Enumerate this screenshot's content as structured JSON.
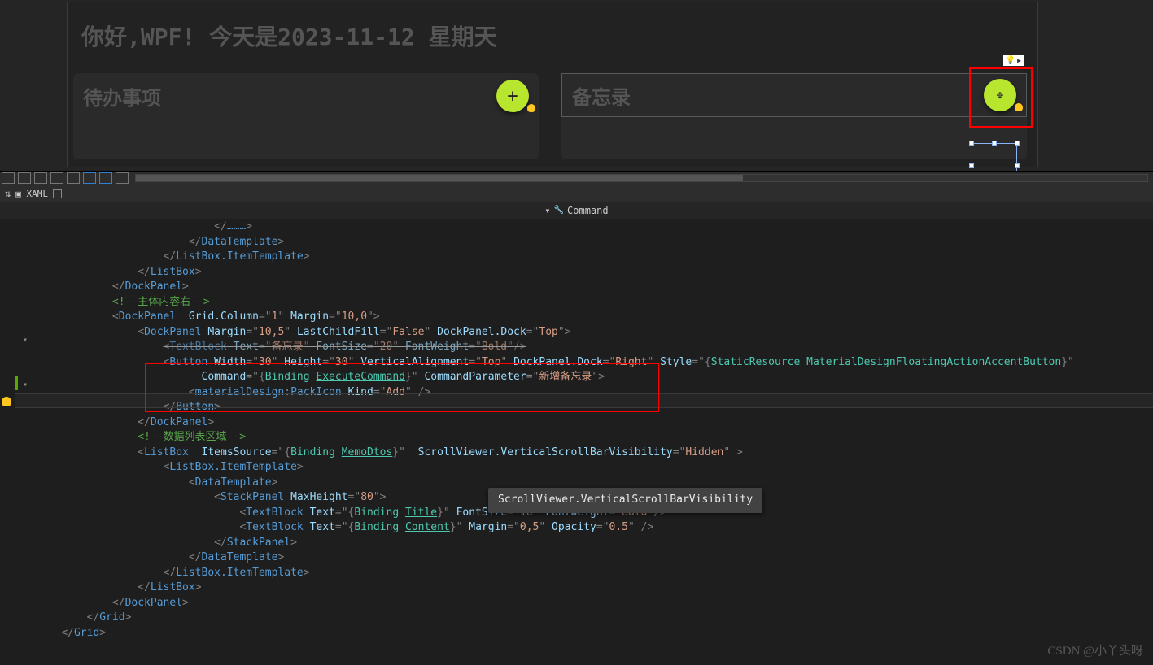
{
  "designer": {
    "title": "你好,WPF! 今天是2023-11-12 星期天",
    "card_todo_label": "待办事项",
    "card_memo_label": "备忘录",
    "fab_glyph": "+",
    "hint_icon": "💡"
  },
  "panel": {
    "swap_glyph": "⇅",
    "tab_label": "▣ XAML",
    "crumb_dropdown": "▾",
    "crumb_icon": "🔧",
    "crumb_text": "Command"
  },
  "code_lines": [
    {
      "ind": 14,
      "html": "<span class='p'>&lt;∕</span><span class='el'>………</span><span class='p'>&gt;</span>"
    },
    {
      "ind": 0,
      "html": ""
    },
    {
      "ind": 12,
      "html": "<span class='p'>&lt;/</span><span class='el'>DataTemplate</span><span class='p'>&gt;</span>"
    },
    {
      "ind": 10,
      "html": "<span class='p'>&lt;/</span><span class='el'>ListBox.ItemTemplate</span><span class='p'>&gt;</span>"
    },
    {
      "ind": 8,
      "html": "<span class='p'>&lt;/</span><span class='el'>ListBox</span><span class='p'>&gt;</span>"
    },
    {
      "ind": 6,
      "html": "<span class='p'>&lt;/</span><span class='el'>DockPanel</span><span class='p'>&gt;</span>"
    },
    {
      "ind": 0,
      "html": ""
    },
    {
      "ind": 6,
      "html": "<span class='cm'>&lt;!--主体内容右--&gt;</span>"
    },
    {
      "ind": 6,
      "html": "<span class='p'>&lt;</span><span class='el'>DockPanel</span><span class='at'>  Grid.Column</span><span class='p'>=&quot;</span><span class='st'>1</span><span class='p'>&quot; </span><span class='at'>Margin</span><span class='p'>=&quot;</span><span class='st'>10,0</span><span class='p'>&quot;&gt;</span>"
    },
    {
      "ind": 8,
      "html": "<span class='p'>&lt;</span><span class='el'>DockPanel</span> <span class='at'>Margin</span><span class='p'>=&quot;</span><span class='st'>10,5</span><span class='p'>&quot; </span><span class='at'>LastChildFill</span><span class='p'>=&quot;</span><span class='st'>False</span><span class='p'>&quot; </span><span class='at'>DockPanel.Dock</span><span class='p'>=&quot;</span><span class='st'>Top</span><span class='p'>&quot;&gt;</span>"
    },
    {
      "ind": 10,
      "html": "<span class='str'><span class='p'>&lt;</span><span class='el'>TextBlock</span> <span class='at'>Text</span><span class='p'>=&quot;</span><span class='st'>备忘录</span><span class='p'>&quot; </span><span class='at'>FontSize</span><span class='p'>=&quot;</span><span class='st'>20</span><span class='p'>&quot; </span><span class='at'>FontWeight</span><span class='p'>=&quot;</span><span class='st'>Bold</span><span class='p'>&quot;/&gt;</span></span>"
    },
    {
      "ind": 10,
      "html": "<span class='p'>&lt;</span><span class='el'>Button</span> <span class='at'>Width</span><span class='p'>=&quot;</span><span class='st'>30</span><span class='p'>&quot; </span><span class='at'>Height</span><span class='p'>=&quot;</span><span class='st'>30</span><span class='p'>&quot; </span><span class='at'>VerticalAlignment</span><span class='p'>=&quot;</span><span class='st'>Top</span><span class='p'>&quot; </span><span class='at'>DockPanel.Dock</span><span class='p'>=&quot;</span><span class='st'>Right</span><span class='p'>&quot; </span><span class='at'>Style</span><span class='p'>=&quot;{</span><span class='bs'>StaticResource</span> <span class='bs'>MaterialDesignFloatingActionAccentButton</span><span class='p'>}&quot;</span>"
    },
    {
      "ind": 13,
      "html": "<span class='at'>Command</span><span class='p'>=&quot;{</span><span class='bs'>Binding</span> <span class='bs'><u>ExecuteCommand</u></span><span class='p'>}&quot; </span><span class='at'>CommandParameter</span><span class='p'>=&quot;</span><span class='st'>新增备忘录</span><span class='p'>&quot;&gt;</span>"
    },
    {
      "ind": 12,
      "html": "<span class='p'>&lt;</span><span class='el'>materialDesign</span><span class='p'>:</span><span class='el'>PackIcon</span> <span class='at'>Kind</span><span class='p'>=&quot;</span><span class='st'>Add</span><span class='p'>&quot; /&gt;</span>"
    },
    {
      "ind": 10,
      "html": "<span class='p'>&lt;/</span><span class='el'>Button</span><span class='p'>&gt;</span>"
    },
    {
      "ind": 8,
      "html": "<span class='p'>&lt;/</span><span class='el'>DockPanel</span><span class='p'>&gt;</span>"
    },
    {
      "ind": 8,
      "html": "<span class='cm'>&lt;!--数据列表区域--&gt;</span>"
    },
    {
      "ind": 8,
      "html": "<span class='p'>&lt;</span><span class='el'>ListBox</span>  <span class='at'>ItemsSource</span><span class='p'>=&quot;{</span><span class='bs'>Binding</span> <span class='bs'><u>MemoDtos</u></span><span class='p'>}&quot;  </span><span class='at'>ScrollViewer.VerticalScrollBarVisibility</span><span class='p'>=&quot;</span><span class='st'>Hidden</span><span class='p'>&quot; &gt;</span>"
    },
    {
      "ind": 10,
      "html": "<span class='p'>&lt;</span><span class='el'>ListBox.ItemTemplate</span><span class='p'>&gt;</span>"
    },
    {
      "ind": 12,
      "html": "<span class='p'>&lt;</span><span class='el'>DataTemplate</span><span class='p'>&gt;</span>"
    },
    {
      "ind": 14,
      "html": "<span class='p'>&lt;</span><span class='el'>StackPanel</span> <span class='at'>MaxHeight</span><span class='p'>=&quot;</span><span class='st'>80</span><span class='p'>&quot;&gt;</span>"
    },
    {
      "ind": 16,
      "html": "<span class='p'>&lt;</span><span class='el'>TextBlock</span> <span class='at'>Text</span><span class='p'>=&quot;{</span><span class='bs'>Binding</span> <span class='bs'><u>Title</u></span><span class='p'>}&quot; </span><span class='at'>FontSize</span><span class='p'>=&quot;</span><span class='st'>16</span><span class='p'>&quot; </span><span class='at'>FontWeight</span><span class='p'>=&quot;</span><span class='st'>Bold</span><span class='p'>&quot;/&gt;</span>"
    },
    {
      "ind": 16,
      "html": "<span class='p'>&lt;</span><span class='el'>TextBlock</span> <span class='at'>Text</span><span class='p'>=&quot;{</span><span class='bs'>Binding</span> <span class='bs'><u>Content</u></span><span class='p'>}&quot; </span><span class='at'>Margin</span><span class='p'>=&quot;</span><span class='st'>0,5</span><span class='p'>&quot; </span><span class='at'>Opacity</span><span class='p'>=&quot;</span><span class='st'>0.5</span><span class='p'>&quot; /&gt;</span>"
    },
    {
      "ind": 14,
      "html": "<span class='p'>&lt;/</span><span class='el'>StackPanel</span><span class='p'>&gt;</span>"
    },
    {
      "ind": 12,
      "html": "<span class='p'>&lt;/</span><span class='el'>DataTemplate</span><span class='p'>&gt;</span>"
    },
    {
      "ind": 10,
      "html": "<span class='p'>&lt;/</span><span class='el'>ListBox.ItemTemplate</span><span class='p'>&gt;</span>"
    },
    {
      "ind": 8,
      "html": "<span class='p'>&lt;/</span><span class='el'>ListBox</span><span class='p'>&gt;</span>"
    },
    {
      "ind": 6,
      "html": "<span class='p'>&lt;/</span><span class='el'>DockPanel</span><span class='p'>&gt;</span>"
    },
    {
      "ind": 4,
      "html": "<span class='p'>&lt;/</span><span class='el'>Grid</span><span class='p'>&gt;</span>"
    },
    {
      "ind": 2,
      "html": "<span class='p'>&lt;/</span><span class='el'>Grid</span><span class='p'>&gt;</span>"
    }
  ],
  "tooltip": "ScrollViewer.VerticalScrollBarVisibility",
  "watermark": "CSDN @小丫头呀"
}
